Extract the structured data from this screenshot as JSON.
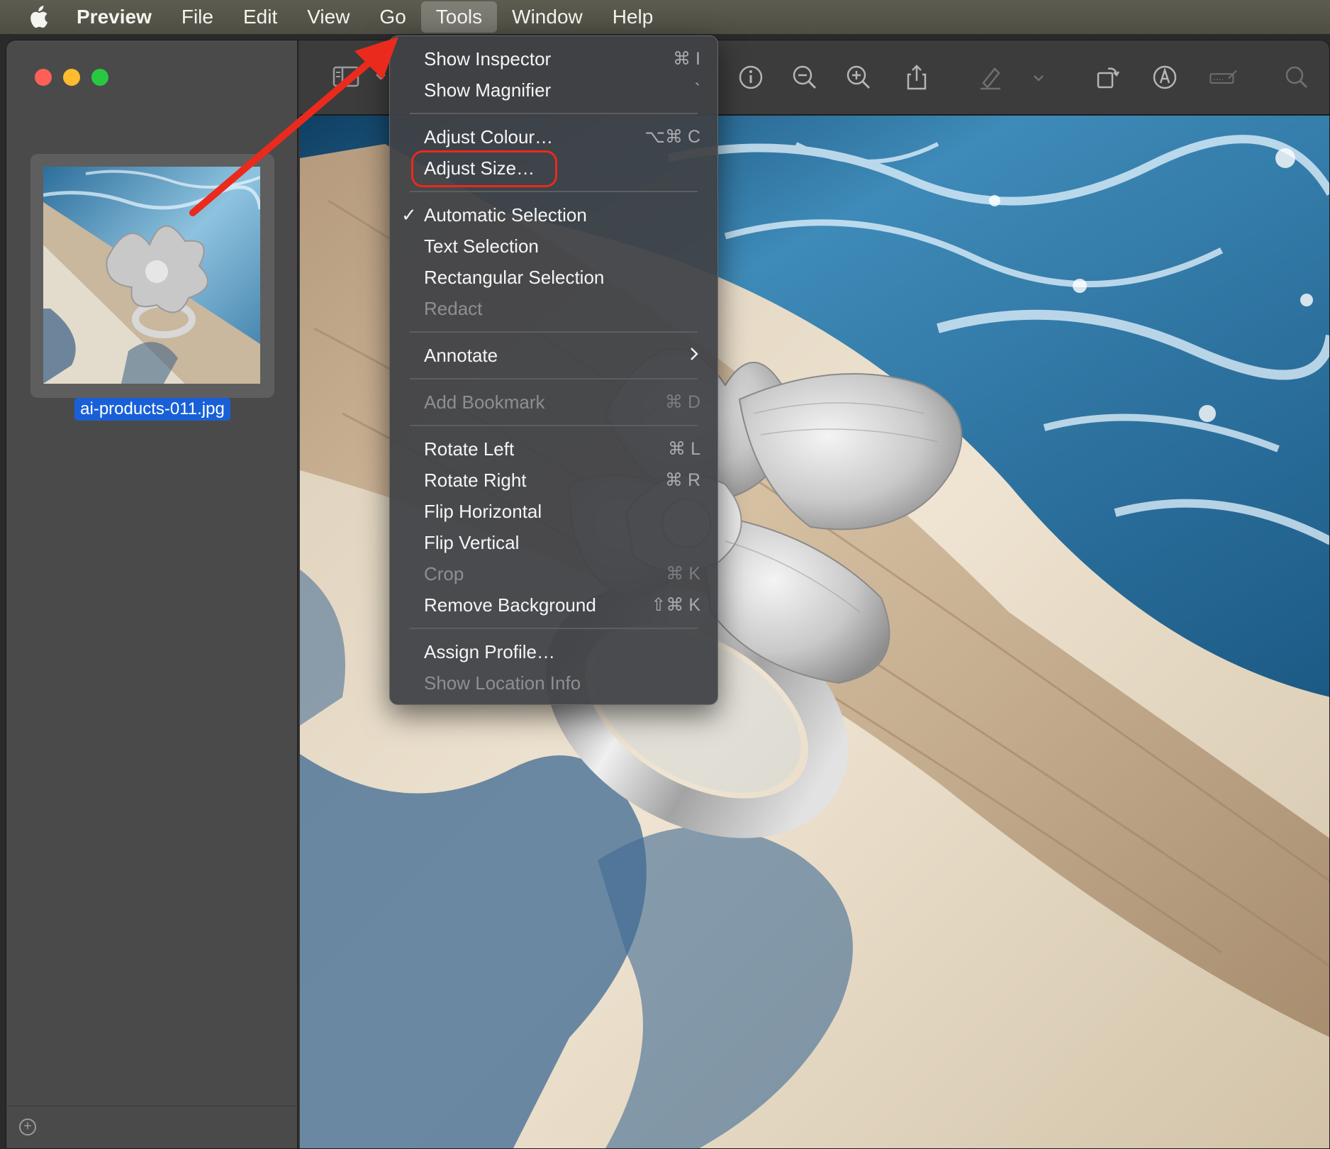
{
  "menubar": {
    "app_name": "Preview",
    "items": [
      "File",
      "Edit",
      "View",
      "Go",
      "Tools",
      "Window",
      "Help"
    ],
    "active": "Tools"
  },
  "sidebar": {
    "thumbnail_filename": "ai-products-011.jpg"
  },
  "toolbar": {
    "icons": [
      "sidebar-toggle-icon",
      "info-icon",
      "zoom-out-icon",
      "zoom-in-icon",
      "share-icon",
      "highlight-pen-icon",
      "rotate-icon",
      "markup-icon",
      "sign-icon",
      "search-icon"
    ]
  },
  "tools_menu": {
    "show_inspector": {
      "label": "Show Inspector",
      "shortcut": "⌘ I"
    },
    "show_magnifier": {
      "label": "Show Magnifier",
      "shortcut": "`"
    },
    "adjust_colour": {
      "label": "Adjust Colour…",
      "shortcut": "⌥⌘ C"
    },
    "adjust_size": {
      "label": "Adjust Size…"
    },
    "automatic_selection": {
      "label": "Automatic Selection",
      "checked": true
    },
    "text_selection": {
      "label": "Text Selection"
    },
    "rectangular_selection": {
      "label": "Rectangular Selection"
    },
    "redact": {
      "label": "Redact"
    },
    "annotate": {
      "label": "Annotate"
    },
    "add_bookmark": {
      "label": "Add Bookmark",
      "shortcut": "⌘ D"
    },
    "rotate_left": {
      "label": "Rotate Left",
      "shortcut": "⌘ L"
    },
    "rotate_right": {
      "label": "Rotate Right",
      "shortcut": "⌘ R"
    },
    "flip_horizontal": {
      "label": "Flip Horizontal"
    },
    "flip_vertical": {
      "label": "Flip Vertical"
    },
    "crop": {
      "label": "Crop",
      "shortcut": "⌘ K"
    },
    "remove_background": {
      "label": "Remove Background",
      "shortcut": "⇧⌘ K"
    },
    "assign_profile": {
      "label": "Assign Profile…"
    },
    "show_location_info": {
      "label": "Show Location Info"
    }
  },
  "colors": {
    "highlight_ring": "#ea2a1d",
    "annotation_arrow": "#ea2a1d",
    "selection_blue": "#1960d8"
  }
}
